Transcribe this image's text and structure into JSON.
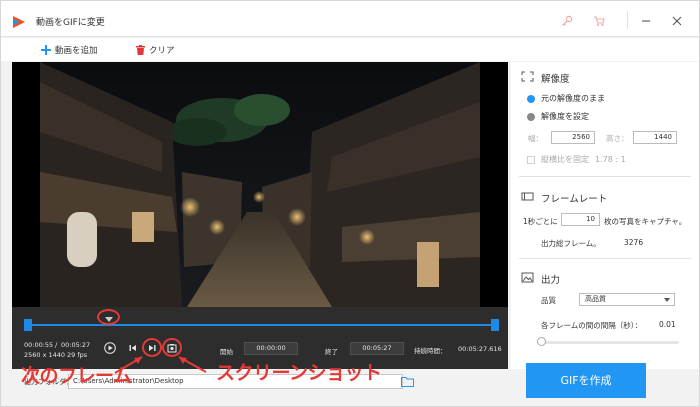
{
  "window": {
    "title": "動画をGIFに変更"
  },
  "toolbar": {
    "add_label": "動画を追加",
    "clear_label": "クリア"
  },
  "player": {
    "time_current": "00:00:55",
    "time_sep": "/",
    "time_total": "00:05:27",
    "resolution": "2560 x 1440",
    "fps": "29 fps",
    "start_label": "開始",
    "start_value": "00:00:00",
    "end_label": "終了",
    "end_value": "00:05:27",
    "duration_label": "持続時間：",
    "duration_value": "00:05:27.616"
  },
  "annotations": {
    "next_frame": "次のフレーム",
    "screenshot": "スクリーンショット"
  },
  "output": {
    "label": "出力フォルダ：",
    "path": "C:\\Users\\Administrator\\Desktop"
  },
  "settings": {
    "resolution": {
      "title": "解像度",
      "option_original": "元の解像度のまま",
      "option_custom": "解像度を設定",
      "width_label": "幅：",
      "width_value": "2560",
      "height_label": "高さ：",
      "height_value": "1440",
      "aspect_label": "縦横比を固定",
      "aspect_value": "1.78 : 1"
    },
    "framerate": {
      "title": "フレームレート",
      "per_sec_prefix": "1秒ごとに",
      "per_sec_value": "10",
      "per_sec_suffix": "枚の写真をキャプチャ。",
      "total_label": "出力総フレーム。",
      "total_value": "3276"
    },
    "output": {
      "title": "出力",
      "quality_label": "品質",
      "quality_value": "高品質",
      "interval_label": "各フレームの間の間隔（秒）：",
      "interval_value": "0.01"
    }
  },
  "actions": {
    "create_label": "GIFを作成"
  },
  "colors": {
    "accent": "#2196f3",
    "annotation": "#e53935",
    "timeline": "#1e88e5"
  }
}
